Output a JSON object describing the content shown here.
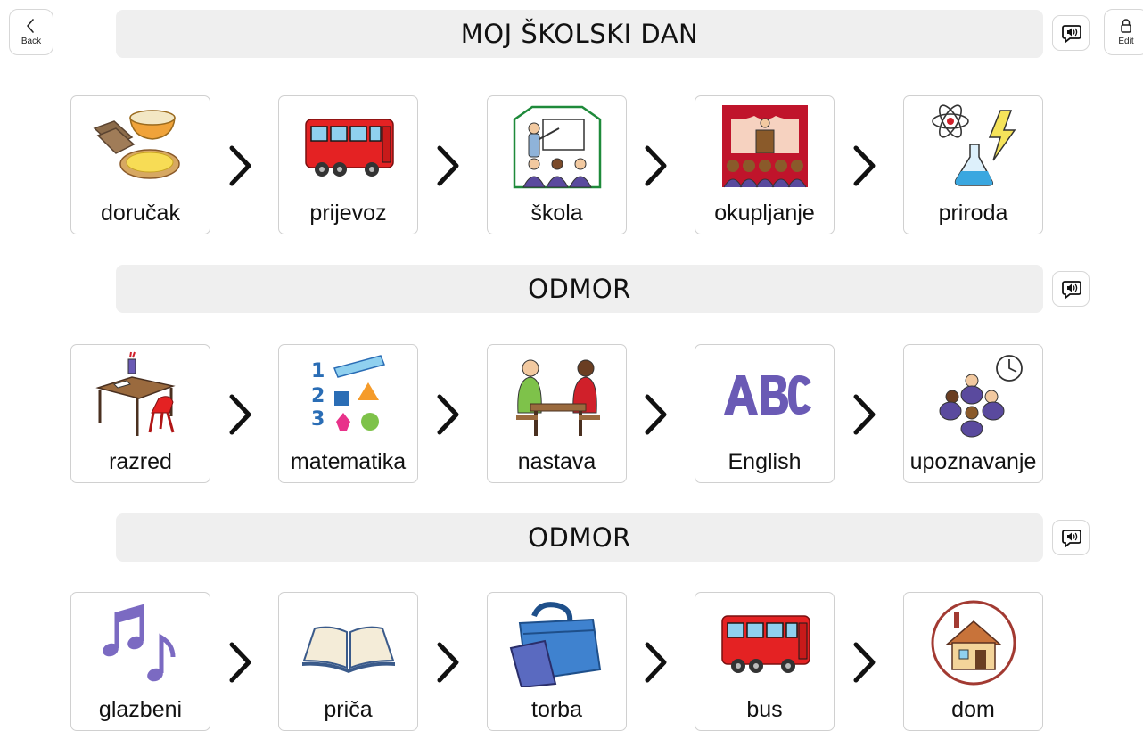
{
  "nav": {
    "back_label": "Back",
    "edit_label": "Edit"
  },
  "headers": [
    "MOJ ŠKOLSKI DAN",
    "ODMOR",
    "ODMOR"
  ],
  "rows": [
    {
      "items": [
        {
          "label": "doručak",
          "icon": "breakfast-icon"
        },
        {
          "label": "prijevoz",
          "icon": "bus-icon"
        },
        {
          "label": "škola",
          "icon": "school-classroom-icon"
        },
        {
          "label": "okupljanje",
          "icon": "assembly-stage-icon"
        },
        {
          "label": "priroda",
          "icon": "science-icon"
        }
      ]
    },
    {
      "items": [
        {
          "label": "razred",
          "icon": "desk-chair-icon"
        },
        {
          "label": "matematika",
          "icon": "math-shapes-icon"
        },
        {
          "label": "nastava",
          "icon": "lesson-people-icon"
        },
        {
          "label": "English",
          "icon": "abc-icon"
        },
        {
          "label": "upoznavanje",
          "icon": "group-circle-icon"
        }
      ]
    },
    {
      "items": [
        {
          "label": "glazbeni",
          "icon": "music-notes-icon"
        },
        {
          "label": "priča",
          "icon": "open-book-icon"
        },
        {
          "label": "torba",
          "icon": "briefcase-icon"
        },
        {
          "label": "bus",
          "icon": "bus-icon"
        },
        {
          "label": "dom",
          "icon": "house-icon"
        }
      ]
    }
  ],
  "colors": {
    "header_bg": "#efefef",
    "bus_red": "#e42223",
    "abc_purple": "#6a5ab5",
    "music_purple": "#7b6ac2",
    "bag_blue": "#3f82cf"
  }
}
